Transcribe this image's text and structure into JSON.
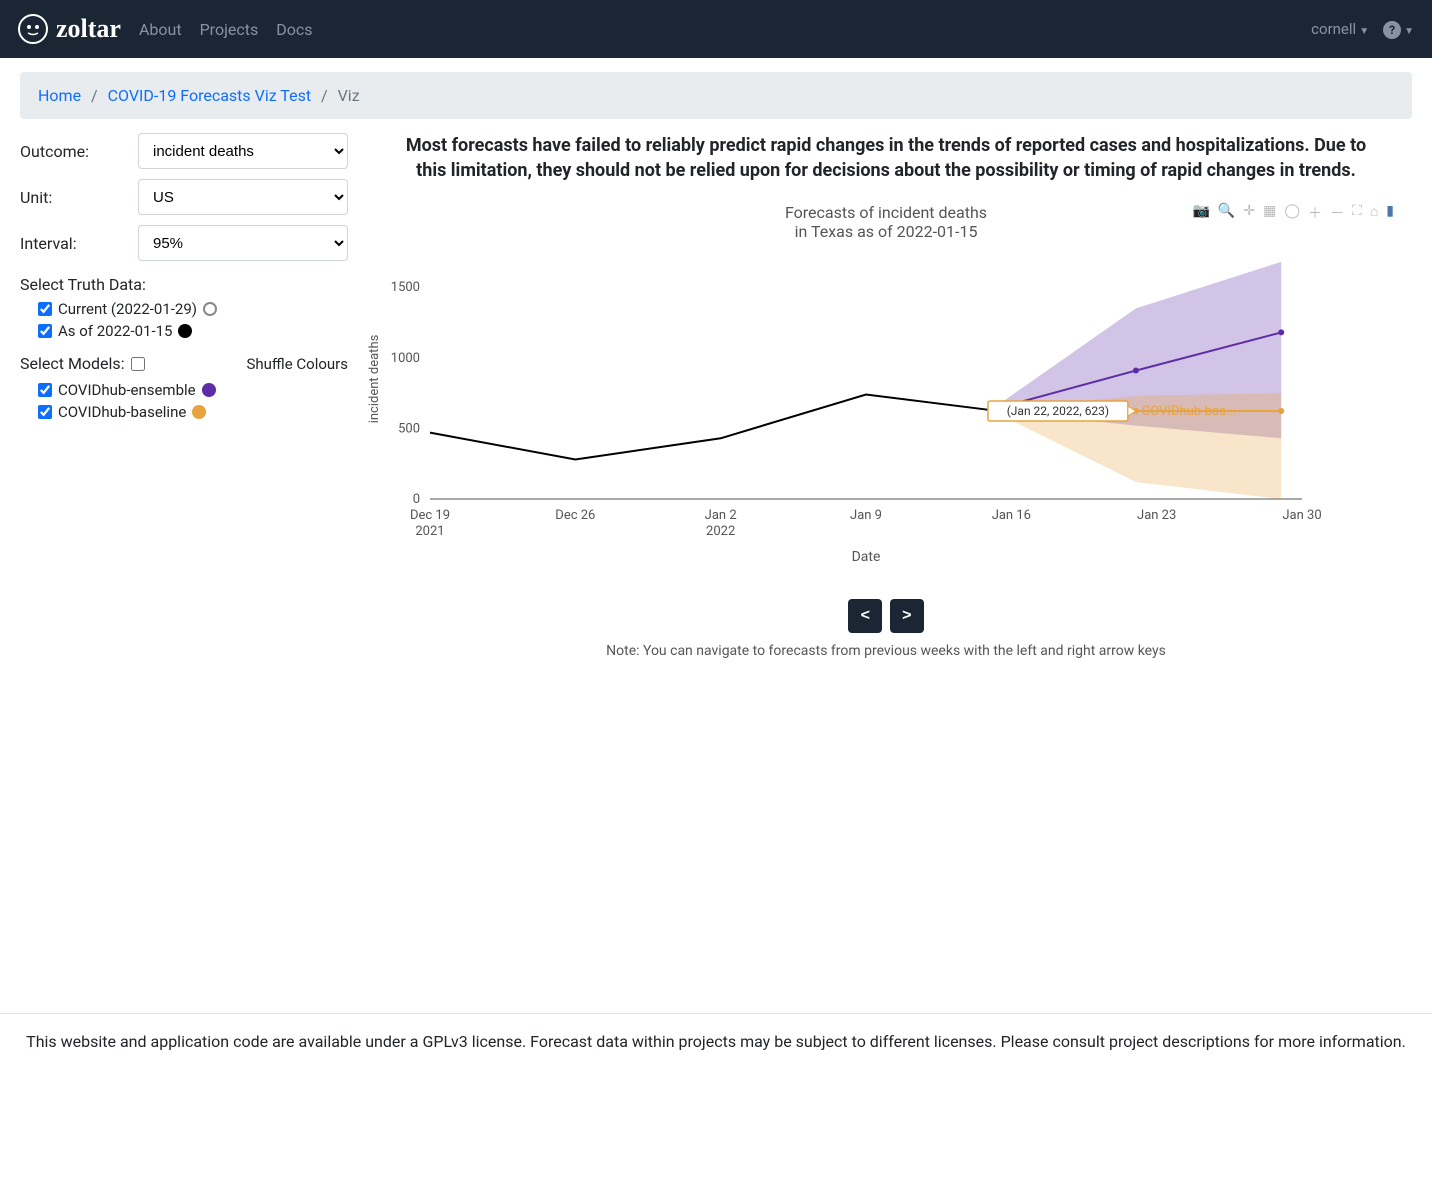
{
  "brand": "zoltar",
  "nav": {
    "about": "About",
    "projects": "Projects",
    "docs": "Docs"
  },
  "user": "cornell",
  "breadcrumb": {
    "home": "Home",
    "project": "COVID-19 Forecasts Viz Test",
    "current": "Viz"
  },
  "form": {
    "outcome_label": "Outcome:",
    "outcome_value": "incident deaths",
    "unit_label": "Unit:",
    "unit_value": "US",
    "interval_label": "Interval:",
    "interval_value": "95%"
  },
  "truth": {
    "label": "Select Truth Data:",
    "items": [
      {
        "label": "Current (2022-01-29)",
        "checked": true,
        "color": "grey"
      },
      {
        "label": "As of 2022-01-15",
        "checked": true,
        "color": "black"
      }
    ]
  },
  "models": {
    "label": "Select Models:",
    "shuffle": "Shuffle Colours",
    "items": [
      {
        "label": "COVIDhub-ensemble",
        "checked": true,
        "color": "purple"
      },
      {
        "label": "COVIDhub-baseline",
        "checked": true,
        "color": "orange"
      }
    ]
  },
  "disclaimer": "Most forecasts have failed to reliably predict rapid changes in the trends of reported cases and hospitalizations. Due to this limitation, they should not be relied upon for decisions about the possibility or timing of rapid changes in trends.",
  "chart_title_l1": "Forecasts of incident deaths",
  "chart_title_l2": "in Texas as of 2022-01-15",
  "tooltip": "(Jan 22, 2022, 623)",
  "tooltip_series": "COVIDhub-bas...",
  "nav_note": "Note: You can navigate to forecasts from previous weeks with the left and right arrow keys",
  "nav_prev": "<",
  "nav_next": ">",
  "footer": "This website and application code are available under a GPLv3 license. Forecast data within projects may be subject to different licenses. Please consult project descriptions for more information.",
  "chart_data": {
    "type": "line",
    "title": "Forecasts of incident deaths in Texas as of 2022-01-15",
    "xlabel": "Date",
    "ylabel": "incident deaths",
    "ylim": [
      0,
      1700
    ],
    "x_ticks": [
      "Dec 19 2021",
      "Dec 26",
      "Jan 2 2022",
      "Jan 9",
      "Jan 16",
      "Jan 23",
      "Jan 30"
    ],
    "y_ticks": [
      0,
      500,
      1000,
      1500
    ],
    "series": [
      {
        "name": "As of 2022-01-15 (truth)",
        "color": "#000000",
        "x": [
          "2021-12-19",
          "2021-12-26",
          "2022-01-02",
          "2022-01-09",
          "2022-01-15"
        ],
        "y": [
          470,
          280,
          430,
          740,
          630
        ]
      },
      {
        "name": "COVIDhub-ensemble",
        "color": "#5e2ca5",
        "x": [
          "2022-01-15",
          "2022-01-22",
          "2022-01-29"
        ],
        "y": [
          630,
          910,
          1180
        ],
        "interval_low": [
          630,
          520,
          430
        ],
        "interval_high": [
          630,
          1350,
          1680
        ]
      },
      {
        "name": "COVIDhub-baseline",
        "color": "#e8a33d",
        "x": [
          "2022-01-15",
          "2022-01-22",
          "2022-01-29"
        ],
        "y": [
          630,
          623,
          623
        ],
        "interval_low": [
          630,
          120,
          0
        ],
        "interval_high": [
          630,
          730,
          750
        ]
      }
    ],
    "hover_point": {
      "series": "COVIDhub-baseline",
      "x": "Jan 22, 2022",
      "y": 623
    }
  }
}
